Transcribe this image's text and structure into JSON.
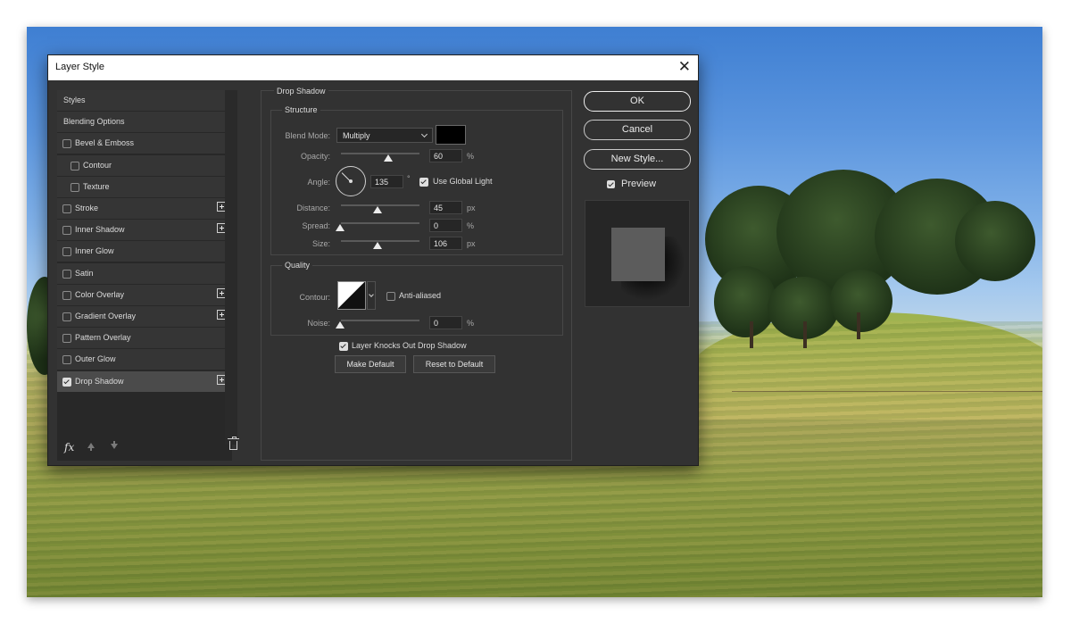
{
  "dialog": {
    "title": "Layer Style",
    "close_label": "✕"
  },
  "styles_list": {
    "items": [
      {
        "label": "Styles",
        "has_checkbox": false,
        "checked": false,
        "has_add": false,
        "indent": false,
        "selected": false
      },
      {
        "label": "Blending Options",
        "has_checkbox": false,
        "checked": false,
        "has_add": false,
        "indent": false,
        "selected": false
      },
      {
        "label": "Bevel & Emboss",
        "has_checkbox": true,
        "checked": false,
        "has_add": false,
        "indent": false,
        "selected": false
      },
      {
        "label": "Contour",
        "has_checkbox": true,
        "checked": false,
        "has_add": false,
        "indent": true,
        "selected": false
      },
      {
        "label": "Texture",
        "has_checkbox": true,
        "checked": false,
        "has_add": false,
        "indent": true,
        "selected": false
      },
      {
        "label": "Stroke",
        "has_checkbox": true,
        "checked": false,
        "has_add": true,
        "indent": false,
        "selected": false
      },
      {
        "label": "Inner Shadow",
        "has_checkbox": true,
        "checked": false,
        "has_add": true,
        "indent": false,
        "selected": false
      },
      {
        "label": "Inner Glow",
        "has_checkbox": true,
        "checked": false,
        "has_add": false,
        "indent": false,
        "selected": false
      },
      {
        "label": "Satin",
        "has_checkbox": true,
        "checked": false,
        "has_add": false,
        "indent": false,
        "selected": false
      },
      {
        "label": "Color Overlay",
        "has_checkbox": true,
        "checked": false,
        "has_add": true,
        "indent": false,
        "selected": false
      },
      {
        "label": "Gradient Overlay",
        "has_checkbox": true,
        "checked": false,
        "has_add": true,
        "indent": false,
        "selected": false
      },
      {
        "label": "Pattern Overlay",
        "has_checkbox": true,
        "checked": false,
        "has_add": false,
        "indent": false,
        "selected": false
      },
      {
        "label": "Outer Glow",
        "has_checkbox": true,
        "checked": false,
        "has_add": false,
        "indent": false,
        "selected": false
      },
      {
        "label": "Drop Shadow",
        "has_checkbox": true,
        "checked": true,
        "has_add": true,
        "indent": false,
        "selected": true
      }
    ],
    "footer_icons": [
      "fx-icon",
      "arrow-up-icon",
      "arrow-down-icon",
      "trash-icon"
    ],
    "fx_label": "fx"
  },
  "drop_shadow": {
    "section_title": "Drop Shadow",
    "structure": {
      "title": "Structure",
      "blend_mode_label": "Blend Mode:",
      "blend_mode_value": "Multiply",
      "shadow_color": "#000000",
      "opacity_label": "Opacity:",
      "opacity_value": "60",
      "opacity_unit": "%",
      "angle_label": "Angle:",
      "angle_value": "135",
      "angle_unit": "°",
      "use_global_light_label": "Use Global Light",
      "use_global_light_checked": true,
      "distance_label": "Distance:",
      "distance_value": "45",
      "distance_unit": "px",
      "spread_label": "Spread:",
      "spread_value": "0",
      "spread_unit": "%",
      "size_label": "Size:",
      "size_value": "106",
      "size_unit": "px"
    },
    "quality": {
      "title": "Quality",
      "contour_label": "Contour:",
      "anti_aliased_label": "Anti-aliased",
      "anti_aliased_checked": false,
      "noise_label": "Noise:",
      "noise_value": "0",
      "noise_unit": "%"
    },
    "layer_knocks_out_label": "Layer Knocks Out Drop Shadow",
    "layer_knocks_out_checked": true,
    "make_default_label": "Make Default",
    "reset_default_label": "Reset to Default"
  },
  "actions": {
    "ok_label": "OK",
    "cancel_label": "Cancel",
    "new_style_label": "New Style...",
    "preview_label": "Preview",
    "preview_checked": true
  },
  "colors": {
    "dialog_bg": "#323232",
    "selected_item": "#4b4b4b",
    "text": "#dcdcdc"
  }
}
